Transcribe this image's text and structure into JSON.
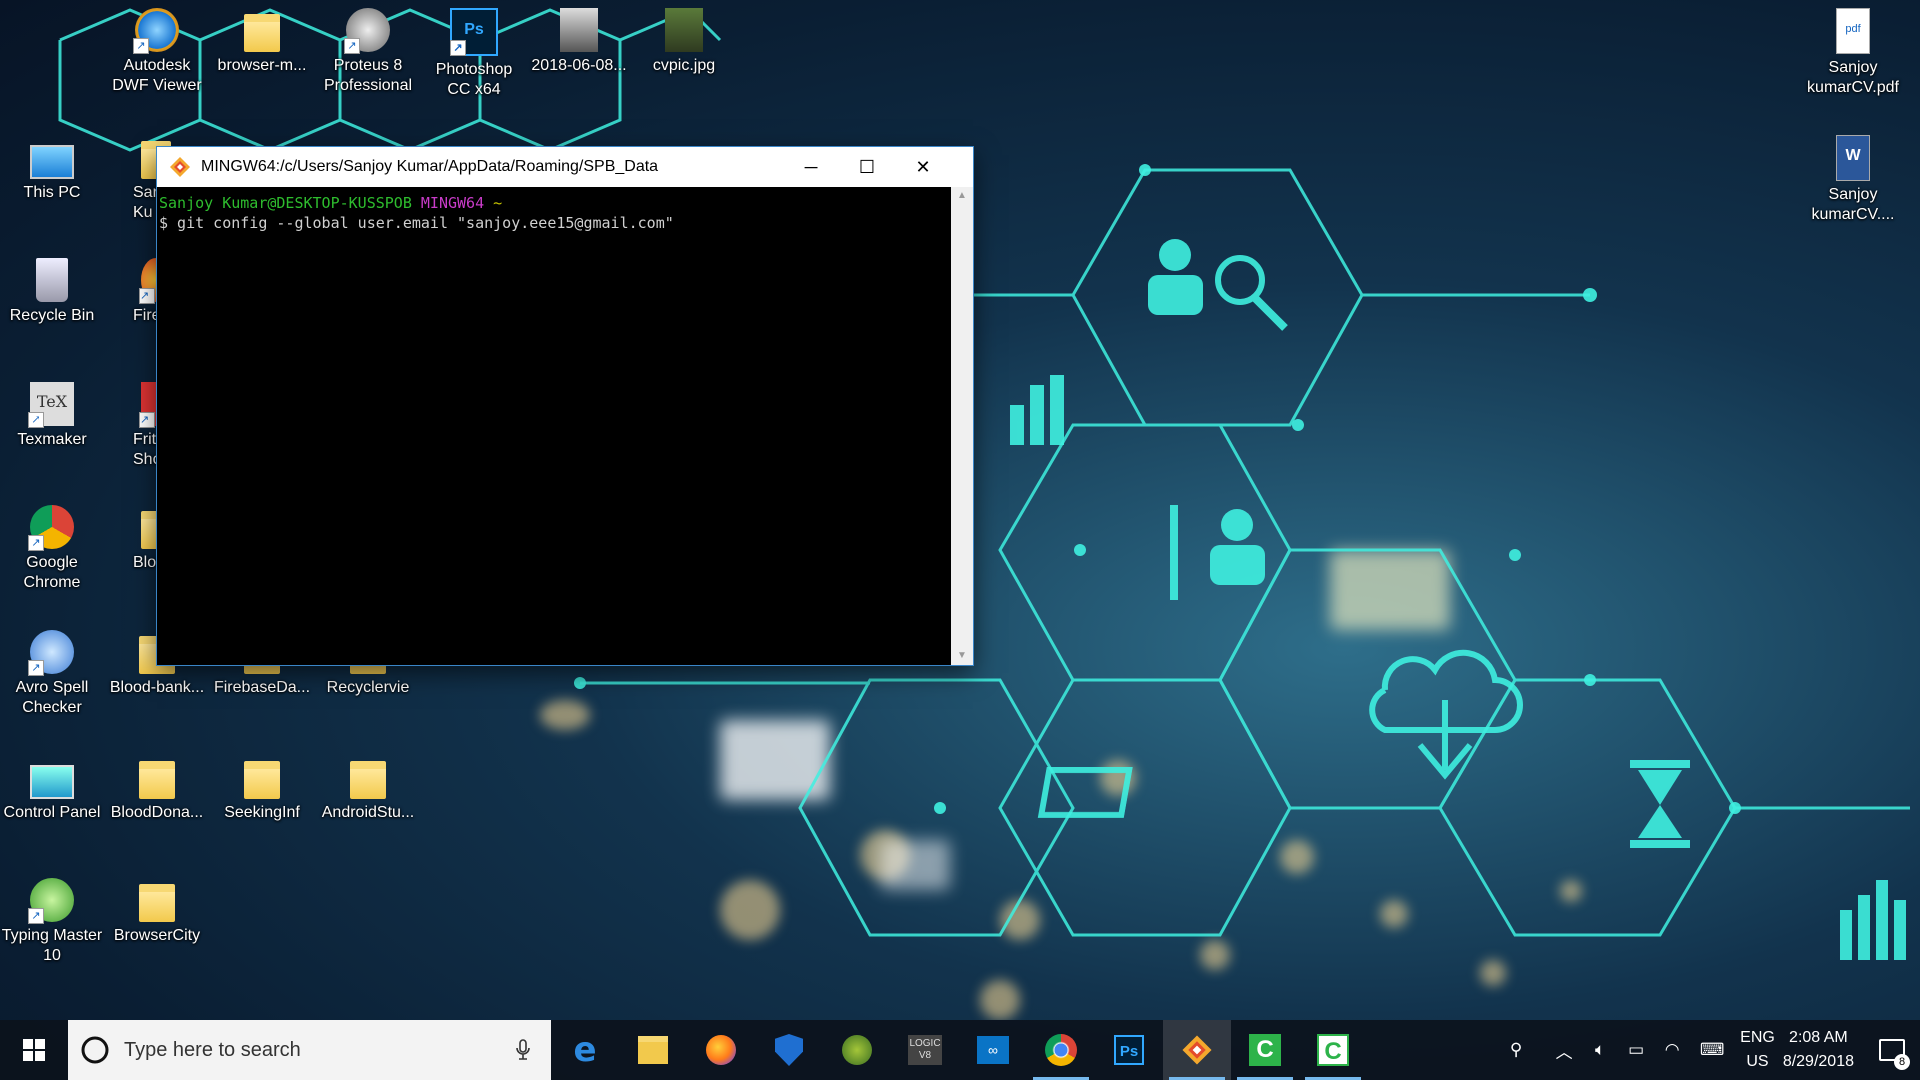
{
  "desktop": {
    "icons_left": [
      {
        "label": "Autodesk DWF Viewer",
        "icon": "autodesk-icon"
      },
      {
        "label": "browser-m...",
        "icon": "folder-icon"
      },
      {
        "label": "Proteus 8 Professional",
        "icon": "proteus-icon"
      },
      {
        "label": "Photoshop CC x64",
        "icon": "photoshop-icon"
      },
      {
        "label": "2018-06-08...",
        "icon": "photo-thumbnail-icon"
      },
      {
        "label": "cvpic.jpg",
        "icon": "photo-thumbnail-icon"
      },
      {
        "label": "This PC",
        "icon": "computer-icon"
      },
      {
        "label": "Recycle Bin",
        "icon": "recycle-bin-icon"
      },
      {
        "label": "Texmaker",
        "icon": "texmaker-icon"
      },
      {
        "label": "Google Chrome",
        "icon": "chrome-icon"
      },
      {
        "label": "Avro Spell Checker",
        "icon": "avro-icon"
      },
      {
        "label": "Control Panel",
        "icon": "control-panel-icon"
      },
      {
        "label": "Typing Master 10",
        "icon": "typing-master-icon"
      },
      {
        "label": "Blood-bank...",
        "icon": "folder-icon"
      },
      {
        "label": "FirebaseDa...",
        "icon": "folder-icon"
      },
      {
        "label": "Recyclervie",
        "icon": "folder-icon"
      },
      {
        "label": "BloodDona...",
        "icon": "folder-icon"
      },
      {
        "label": "SeekingInf",
        "icon": "folder-icon"
      },
      {
        "label": "AndroidStu...",
        "icon": "folder-icon"
      },
      {
        "label": "BrowserCity",
        "icon": "folder-icon"
      }
    ],
    "partial_labels": [
      "Sar",
      "Ku",
      "Fire",
      "Fritzin",
      "Sho",
      "Blood"
    ],
    "icons_right": [
      {
        "label": "Sanjoy kumarCV.pdf",
        "icon": "pdf-icon"
      },
      {
        "label": "Sanjoy kumarCV....",
        "icon": "word-doc-icon"
      }
    ]
  },
  "terminal": {
    "title": "MINGW64:/c/Users/Sanjoy Kumar/AppData/Roaming/SPB_Data",
    "prompt_user": "Sanjoy Kumar@DESKTOP-KUSSPOB",
    "prompt_env": "MINGW64",
    "prompt_path": "~",
    "command_line": "$ git config --global user.email \"sanjoy.eee15@gmail.com\"",
    "controls": {
      "minimize": "─",
      "maximize": "☐",
      "close": "✕"
    }
  },
  "taskbar": {
    "search_placeholder": "Type here to search",
    "apps": [
      {
        "name": "edge-icon",
        "open": false
      },
      {
        "name": "file-explorer-icon",
        "open": false
      },
      {
        "name": "firefox-icon",
        "open": false
      },
      {
        "name": "defender-icon",
        "open": false
      },
      {
        "name": "android-studio-icon",
        "open": false
      },
      {
        "name": "logicworks-icon",
        "open": false
      },
      {
        "name": "arduino-icon",
        "open": false
      },
      {
        "name": "chrome-icon",
        "open": true
      },
      {
        "name": "photoshop-icon",
        "open": false
      },
      {
        "name": "git-bash-icon",
        "open": true,
        "active": true
      },
      {
        "name": "camtasia-icon",
        "open": true
      },
      {
        "name": "camtasia-recorder-icon",
        "open": true
      }
    ],
    "tray": {
      "lang_top": "ENG",
      "lang_bottom": "US",
      "time": "2:08 AM",
      "date": "8/29/2018",
      "notification_count": "8"
    },
    "colors": {
      "accent": "#76b9ed",
      "prompt_green": "#2ebd2e",
      "prompt_magenta": "#c93cc9",
      "prompt_yellow": "#c7c400",
      "terminal_text": "#d0d0d0"
    }
  }
}
